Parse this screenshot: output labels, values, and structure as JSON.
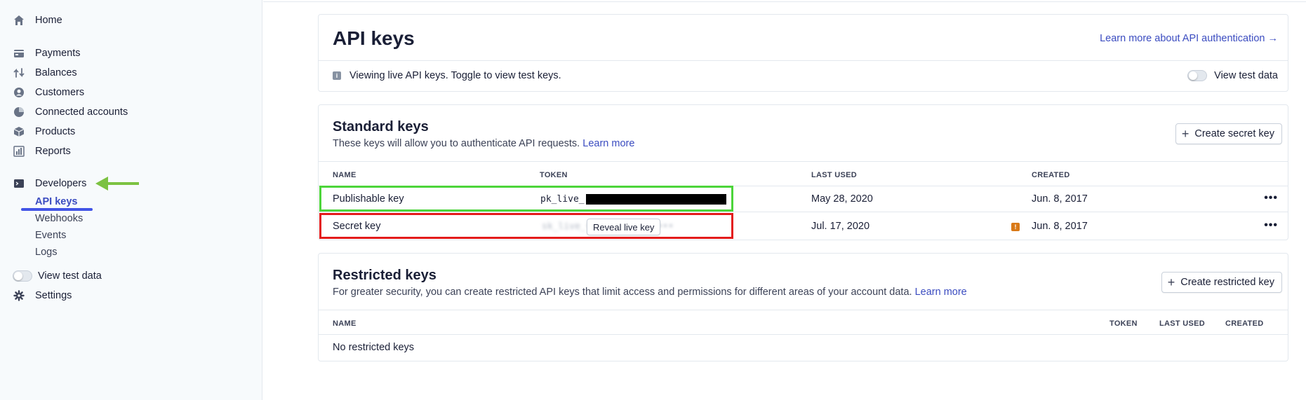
{
  "sidebar": {
    "home": "Home",
    "payments": "Payments",
    "balances": "Balances",
    "customers": "Customers",
    "connected_accounts": "Connected accounts",
    "products": "Products",
    "reports": "Reports",
    "developers": "Developers",
    "sub_items": [
      "API keys",
      "Webhooks",
      "Events",
      "Logs"
    ],
    "view_test_data": "View test data",
    "settings": "Settings"
  },
  "header": {
    "title": "API keys",
    "learn_more": "Learn more about API authentication →",
    "info_text": "Viewing live API keys. Toggle to view test keys.",
    "view_test_data": "View test data"
  },
  "standard_keys": {
    "title": "Standard keys",
    "description": "These keys will allow you to authenticate API requests.",
    "learn_more": "Learn more",
    "create_button": "Create secret key",
    "columns": [
      "NAME",
      "TOKEN",
      "LAST USED",
      "CREATED"
    ],
    "rows": [
      {
        "name": "Publishable key",
        "token_prefix": "pk_live_",
        "last_used": "May 28, 2020",
        "created": "Jun. 8, 2017"
      },
      {
        "name": "Secret key",
        "token_masked": "sk_live_••••••••••••••••",
        "reveal_label": "Reveal live key",
        "last_used": "Jul. 17, 2020",
        "created": "Jun. 8, 2017"
      }
    ],
    "more": "•••"
  },
  "restricted_keys": {
    "title": "Restricted keys",
    "description": "For greater security, you can create restricted API keys that limit access and permissions for different areas of your account data.",
    "learn_more": "Learn more",
    "create_button": "Create restricted key",
    "columns": [
      "NAME",
      "TOKEN",
      "LAST USED",
      "CREATED"
    ],
    "empty": "No restricted keys"
  },
  "colors": {
    "accent": "#3b4cc0",
    "highlight_publishable": "#4cd53a",
    "highlight_secret": "#e31b1b",
    "arrow": "#7cc242"
  }
}
